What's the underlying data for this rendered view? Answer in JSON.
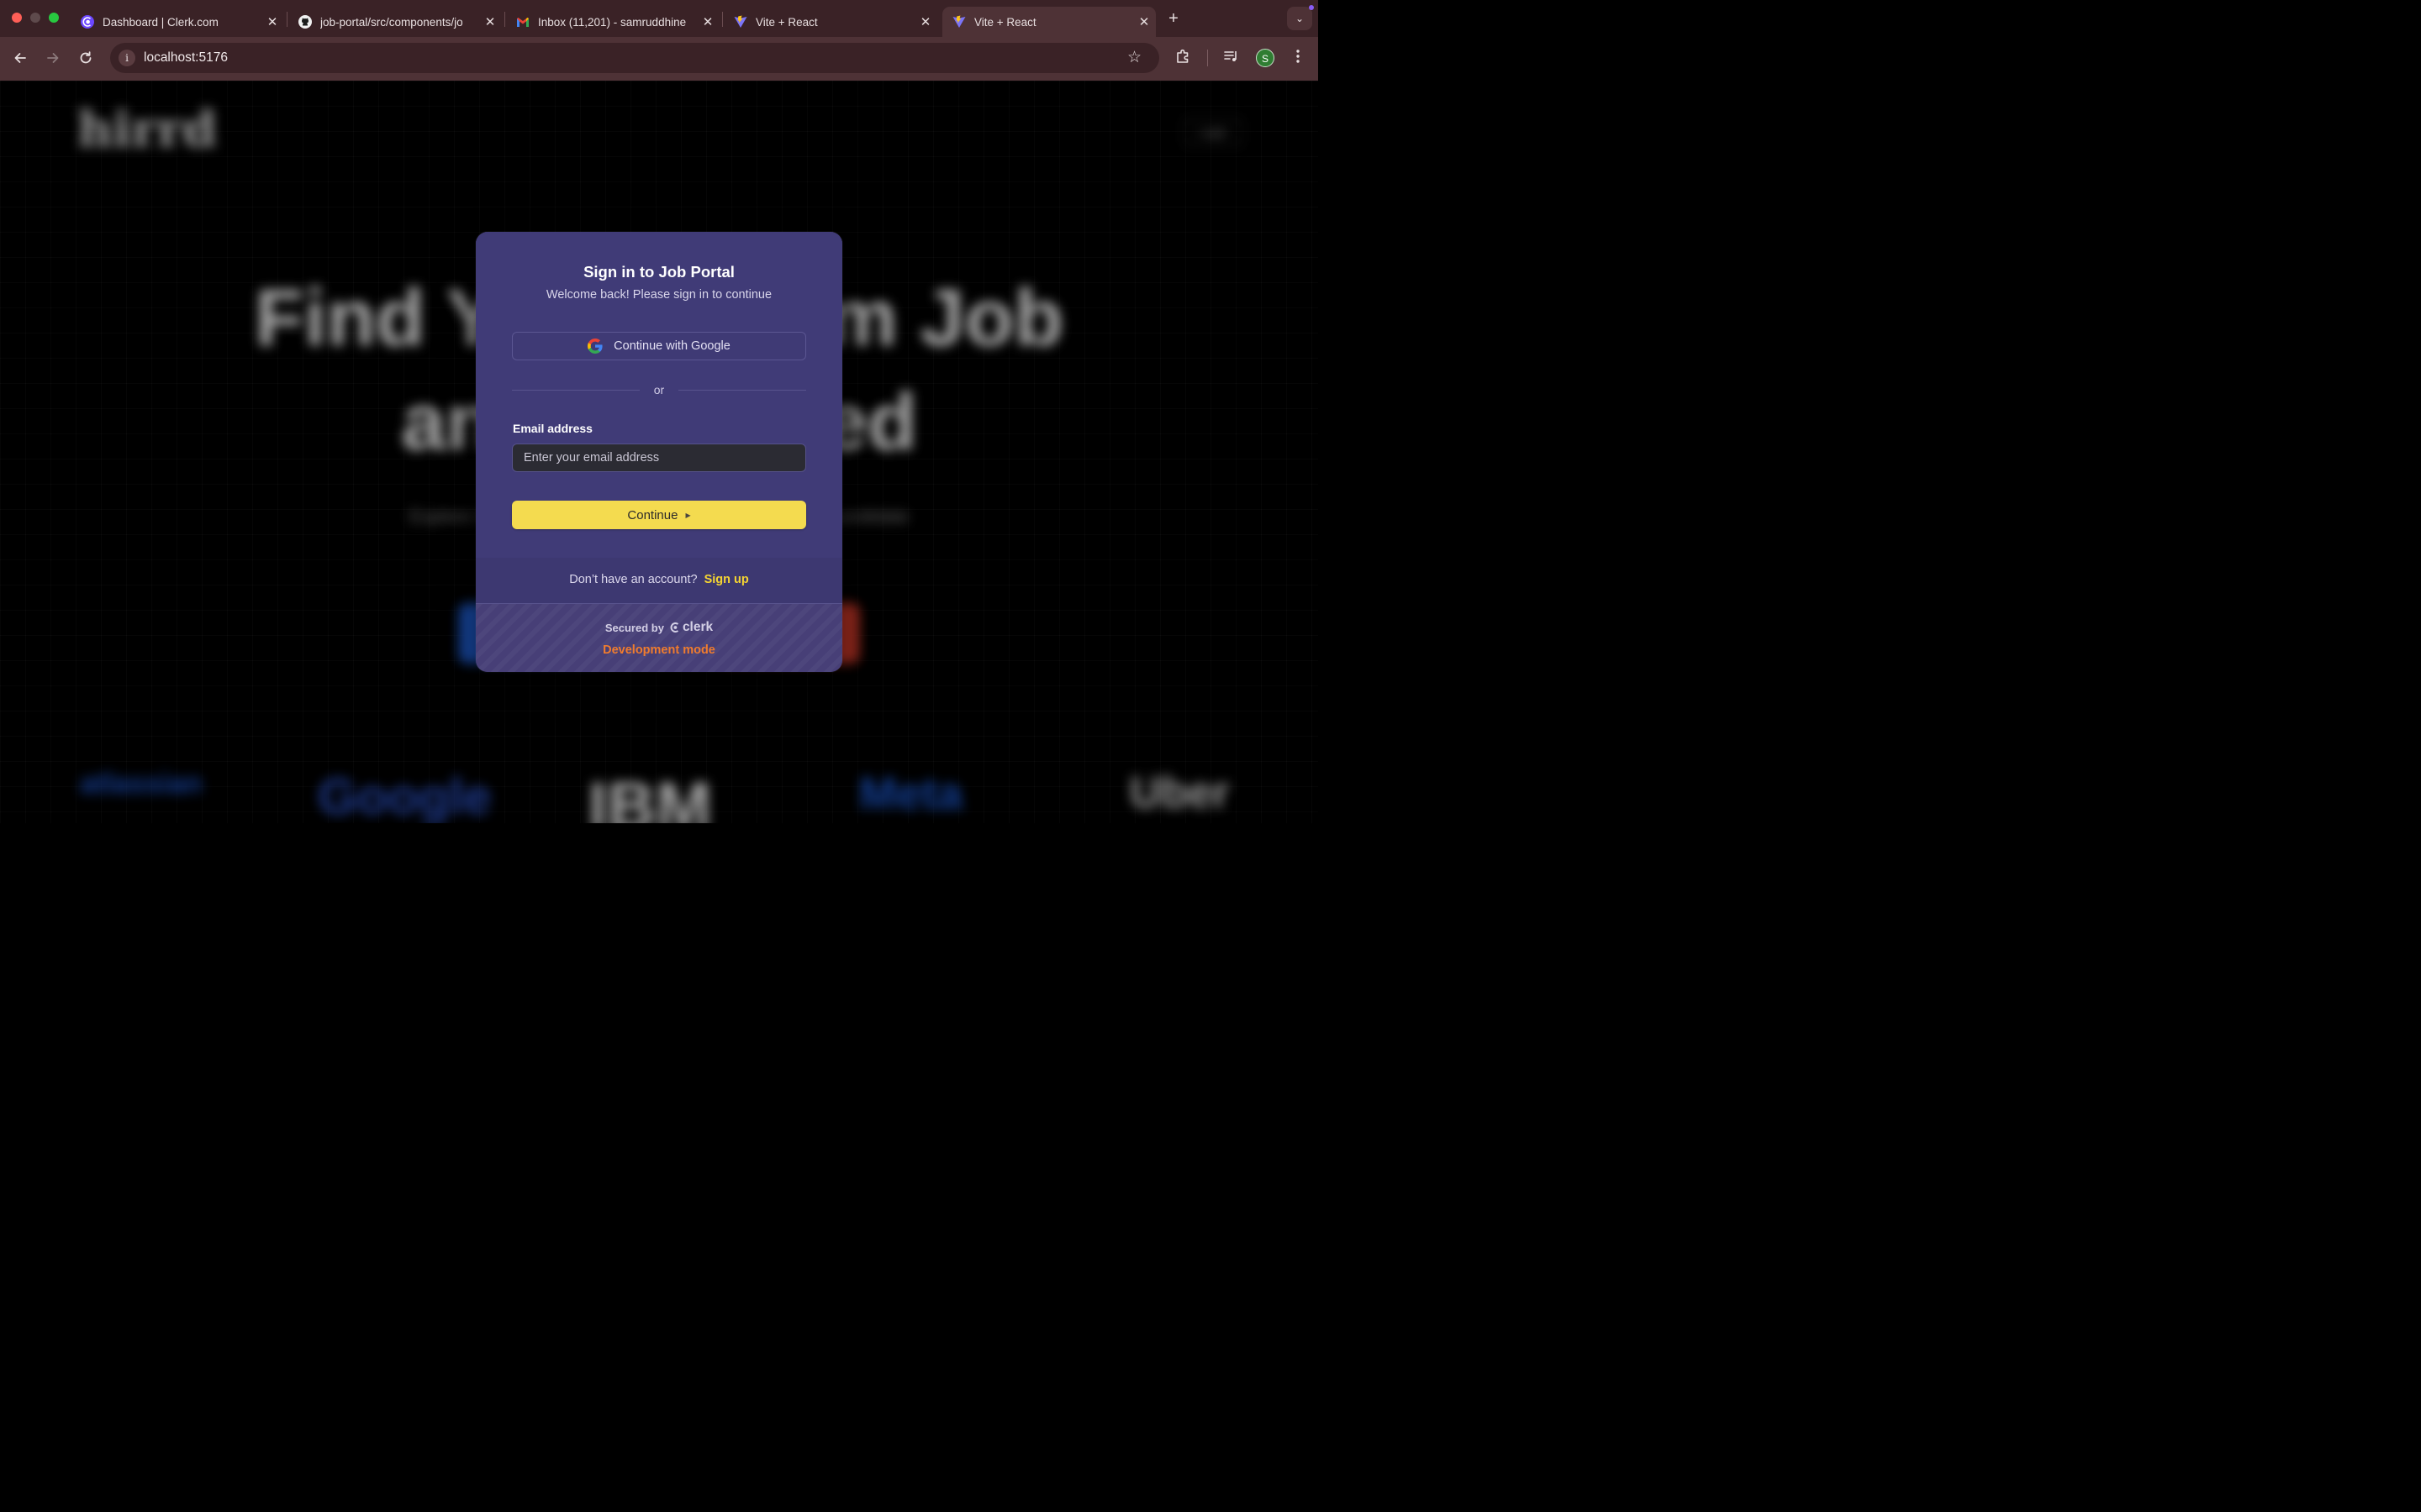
{
  "browser": {
    "tabs": [
      {
        "title": "Dashboard | Clerk.com",
        "favicon": "clerk-icon",
        "active": false
      },
      {
        "title": "job-portal/src/components/jo",
        "favicon": "github-icon",
        "active": false
      },
      {
        "title": "Inbox (11,201) - samruddhine",
        "favicon": "gmail-icon",
        "active": false
      },
      {
        "title": "Vite + React",
        "favicon": "vite-icon",
        "active": false
      },
      {
        "title": "Vite + React",
        "favicon": "vite-icon",
        "active": true
      }
    ],
    "close_glyph": "✕",
    "new_tab_glyph": "+",
    "tab_search_glyph": "⌄",
    "url": "localhost:5176",
    "profile_initial": "S",
    "accent_colors": {
      "frame": "#3a2226",
      "toolbar": "#4e3236"
    }
  },
  "page_background": {
    "logo_text": "hirrd",
    "login_button": "Login",
    "headline_line1": "Find Your Dream Job",
    "headline_line2": "and get Hired",
    "subheadline": "Explore thousands of job listings or find the perfect candidate",
    "companies": [
      "atlassian",
      "Google",
      "IBM",
      "Meta",
      "Uber"
    ]
  },
  "signin": {
    "title": "Sign in to Job Portal",
    "subtitle": "Welcome back! Please sign in to continue",
    "google_button_label": "Continue with Google",
    "divider_text": "or",
    "email_label": "Email address",
    "email_value": "",
    "email_placeholder": "Enter your email address",
    "continue_label": "Continue",
    "no_account_text": "Don’t have an account?",
    "signup_link": "Sign up",
    "secured_by": "Secured by",
    "clerk_brand": "clerk",
    "dev_mode": "Development mode",
    "colors": {
      "card": "#403b77",
      "primary_button": "#f4db4f",
      "link": "#f6d532",
      "dev_mode": "#f07c2e"
    }
  }
}
